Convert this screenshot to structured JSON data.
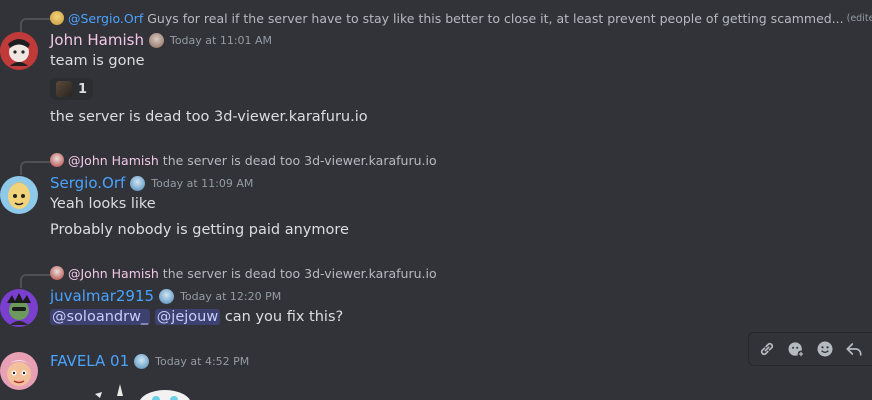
{
  "colors": {
    "background": "#313338",
    "john_color": "#f2c7e6",
    "blue_name": "#4aa3ff",
    "mention_bg": "#3c4270"
  },
  "messages": [
    {
      "reply": {
        "name": "@Sergio.Orf",
        "text": "Guys for real if the server have to stay like this better to close it, at least prevent people of getting scammed...",
        "edited": "(edited)"
      },
      "author": "John Hamish",
      "timestamp": "Today at 11:01 AM",
      "lines": [
        "team is gone"
      ],
      "reaction": {
        "count": "1"
      },
      "extra_line": "the server is dead too 3d-viewer.karafuru.io"
    },
    {
      "reply": {
        "name": "@John Hamish",
        "text": "the server is dead too 3d-viewer.karafuru.io"
      },
      "author": "Sergio.Orf",
      "timestamp": "Today at 11:09 AM",
      "lines": [
        "Yeah looks like",
        "Probably nobody is getting paid anymore"
      ]
    },
    {
      "reply": {
        "name": "@John Hamish",
        "text": "the server is dead too 3d-viewer.karafuru.io"
      },
      "author": "juvalmar2915",
      "timestamp": "Today at 12:20 PM",
      "mentions": [
        "@soloandrw_",
        "@jejouw"
      ],
      "tail": "can you fix this?"
    },
    {
      "author": "FAVELA 01",
      "timestamp": "Today at 4:52 PM"
    }
  ],
  "toolbar": {
    "icons": [
      "link-icon",
      "add-reaction-icon",
      "emoji-icon",
      "reply-icon"
    ]
  }
}
